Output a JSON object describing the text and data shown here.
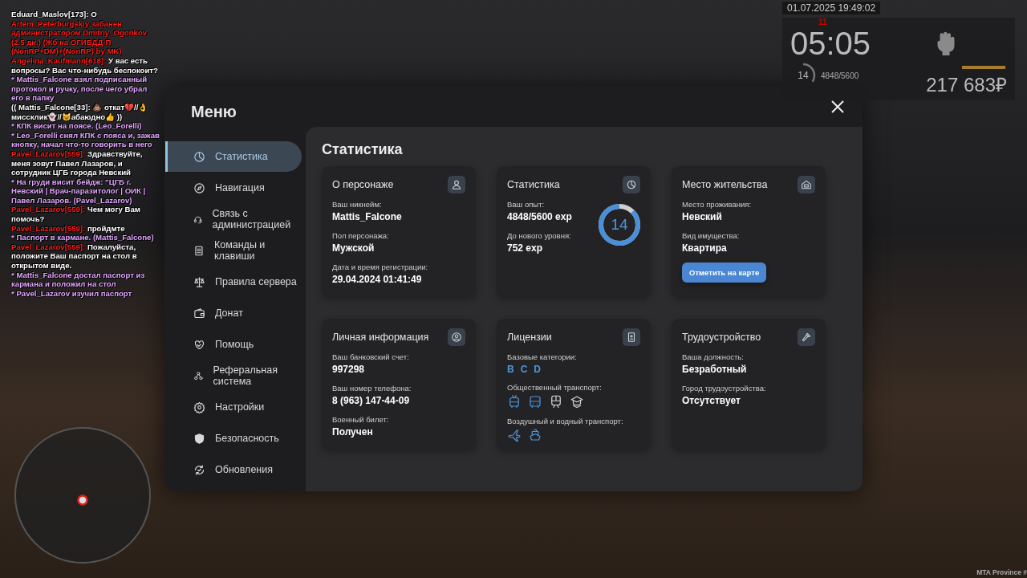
{
  "chat": [
    {
      "kind": "plain",
      "text": "Eduard_Maslov[173]: О"
    },
    {
      "kind": "ban",
      "text": "Artem_Peterburgskiy забанен администратором Dmitriy_Ogonkov (2.5 дн.) (Жб на ОГИБДД-П (NonRP+DM)+(NonRP) by MK)"
    },
    {
      "kind": "say",
      "name": "Angelina_Kaufmann[618]:",
      "text": "У вас есть вопросы? Вас что-нибудь беспокоит?"
    },
    {
      "kind": "action",
      "text": "* Mattis_Falcone взял подписанный протокол и ручку, после чего убрал его в папку"
    },
    {
      "kind": "plain",
      "text": "(( Mattis_Falcone[33]: 💩 откат💔//👌миссклик👻//😺абаюдно👍 ))"
    },
    {
      "kind": "action",
      "text": "* КПК висит на поясе. (Leo_Forelli)"
    },
    {
      "kind": "action",
      "text": "* Leo_Forelli снял КПК с пояса и, зажав кнопку, начал что-то говорить в него"
    },
    {
      "kind": "say",
      "name": "Pavel_Lazarov[559]:",
      "text": "Здравствуйте, меня зовут Павел Лазаров, и сотрудник ЦГБ города Невский"
    },
    {
      "kind": "action",
      "text": "* На груди висит бейдж: \"ЦГБ г. Невский | Врач-паразитолог | ОИК | Павел Лазаров. (Pavel_Lazarov)"
    },
    {
      "kind": "say",
      "name": "Pavel_Lazarov[559]:",
      "text": "Чем могу Вам помочь?"
    },
    {
      "kind": "say",
      "name": "Pavel_Lazarov[559]:",
      "text": "пройдмте"
    },
    {
      "kind": "action",
      "text": "* Паспорт в кармане. (Mattis_Falcone)"
    },
    {
      "kind": "say",
      "name": "Pavel_Lazarov[559]:",
      "text": "Пожалуйста, положите Ваш паспорт на стол в открытом виде."
    },
    {
      "kind": "action",
      "text": "* Mattis_Falcone достал паспорт из кармана и положил на стол"
    },
    {
      "kind": "action",
      "text": "* Pavel_Lazarov изучил паспорт"
    }
  ],
  "hud": {
    "datetime": "01.07.2025 19:49:02",
    "marker": "11",
    "clock": "05:05",
    "level": "14",
    "exp": "4848/5600",
    "money": "217 683₽"
  },
  "menu": {
    "title": "Меню",
    "items": [
      {
        "label": "Статистика",
        "selected": true
      },
      {
        "label": "Навигация",
        "selected": false
      },
      {
        "label": "Связь с администрацией",
        "selected": false
      },
      {
        "label": "Команды и клавиши",
        "selected": false
      },
      {
        "label": "Правила сервера",
        "selected": false
      },
      {
        "label": "Донат",
        "selected": false
      },
      {
        "label": "Помощь",
        "selected": false
      },
      {
        "label": "Реферальная система",
        "selected": false
      },
      {
        "label": "Настройки",
        "selected": false
      },
      {
        "label": "Безопасность",
        "selected": false
      },
      {
        "label": "Обновления",
        "selected": false
      }
    ],
    "heading": "Статистика",
    "cards": [
      {
        "title": "О персонаже",
        "fields": [
          {
            "label": "Ваш никнейм:",
            "value": "Mattis_Falcone"
          },
          {
            "label": "Пол персонажа:",
            "value": "Мужской"
          },
          {
            "label": "Дата и время регистрации:",
            "value": "29.04.2024 01:41:49"
          }
        ]
      },
      {
        "title": "Статистика",
        "fields": [
          {
            "label": "Ваш опыт:",
            "value": "4848/5600 exp"
          },
          {
            "label": "До нового уровня:",
            "value": "752 exp"
          }
        ],
        "ring": {
          "text": "14",
          "level": 0.87
        }
      },
      {
        "title": "Место жительства",
        "fields": [
          {
            "label": "Место проживания:",
            "value": "Невский"
          },
          {
            "label": "Вид имущества:",
            "value": "Квартира"
          }
        ],
        "button": "Отметить на карте"
      },
      {
        "title": "Личная информация",
        "fields": [
          {
            "label": "Ваш банковский счет:",
            "value": "997298"
          },
          {
            "label": "Ваш номер телефона:",
            "value": "8 (963) 147-44-09"
          },
          {
            "label": "Военный билет:",
            "value": "Получен"
          }
        ]
      },
      {
        "title": "Лицензии",
        "fields": [
          {
            "label": "Базовые категории:",
            "categories": [
              "B",
              "C",
              "D"
            ]
          },
          {
            "label": "Общественный транспорт:",
            "vehicles": [
              {
                "owned": true
              },
              {
                "owned": true
              },
              {
                "owned": false
              },
              {
                "owned": false
              }
            ]
          },
          {
            "label": "Воздушный и водный транспорт:",
            "vehicles": [
              {
                "owned": true
              },
              {
                "owned": true
              }
            ]
          }
        ]
      },
      {
        "title": "Трудоустройство",
        "fields": [
          {
            "label": "Ваша должность:",
            "value": "Безработный"
          },
          {
            "label": "Город трудоустройства:",
            "value": "Отсутствует"
          }
        ]
      }
    ]
  },
  "server_label": "MTA Province #"
}
